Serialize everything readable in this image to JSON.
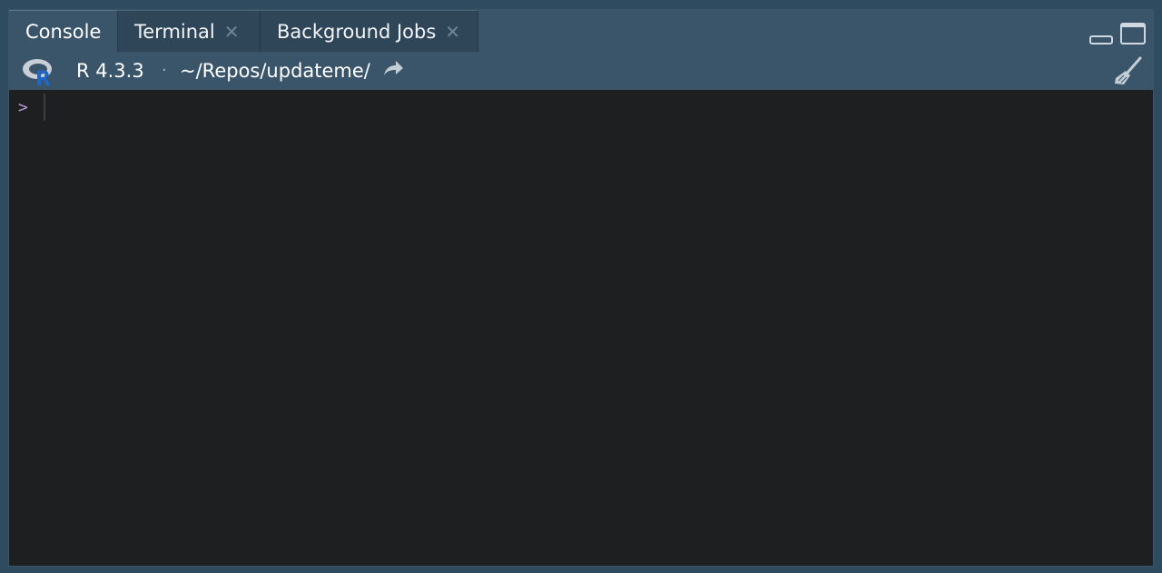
{
  "tabs": [
    {
      "label": "Console",
      "active": true,
      "closable": false
    },
    {
      "label": "Terminal",
      "active": false,
      "closable": true
    },
    {
      "label": "Background Jobs",
      "active": false,
      "closable": true
    }
  ],
  "toolbar": {
    "r_version": "R 4.3.3",
    "separator": "·",
    "working_dir": "~/Repos/updateme/"
  },
  "console": {
    "prompt": ">"
  },
  "colors": {
    "tabbar": "#3a556a",
    "console_bg": "#1e1f21",
    "prompt": "#b79bd4"
  },
  "icons": {
    "r_logo": "r-logo-icon",
    "goto_dir": "goto-directory-icon",
    "clear": "broom-icon",
    "minimize": "minimize-icon",
    "maximize": "maximize-icon"
  }
}
